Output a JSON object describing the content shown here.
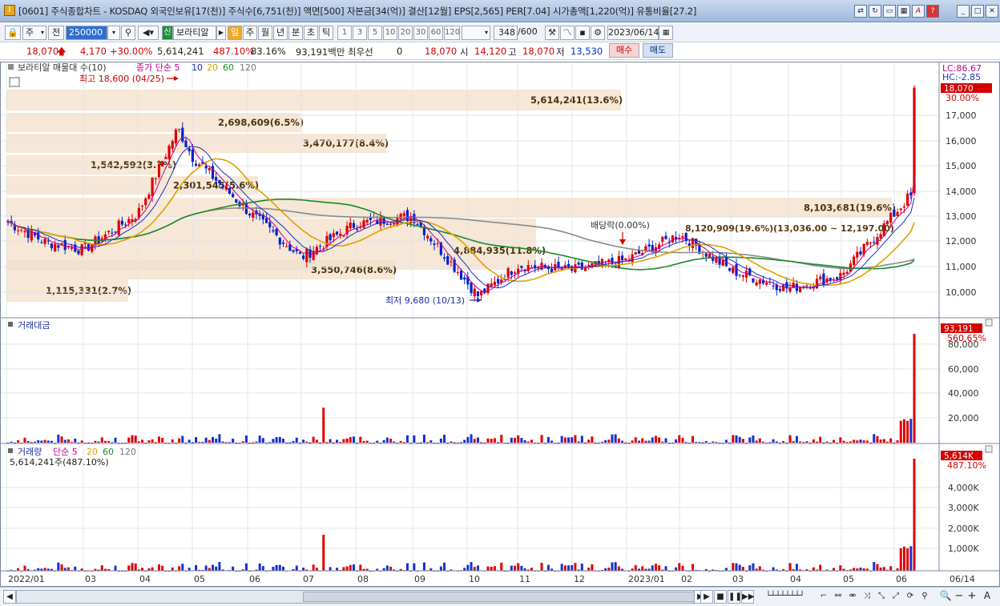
{
  "title": {
    "icon": "chart-app-icon",
    "text": "[0601] 주식종합차트 - KOSDAQ 외국인보유[17(천)] 주식수[6,751(천)] 액면[500] 자본금[34(억)] 결산[12월] EPS[2,565] PER[7.04] 시가총액[1,220(억)] 유통비율[27.2]",
    "buttons": [
      "link-icon",
      "refresh-icon",
      "window-icon",
      "table-icon",
      "font-icon",
      "help-icon",
      "minimize-icon",
      "maximize-icon",
      "close-icon"
    ]
  },
  "toolbar": {
    "type_select": "주",
    "prev_label": "전",
    "code_value": "250000",
    "stock_tag": "신",
    "stock_name": "보라티알",
    "periods": [
      "일",
      "주",
      "월",
      "년",
      "분",
      "초",
      "틱"
    ],
    "active_period": "일",
    "minute_steps": [
      "1",
      "3",
      "5",
      "10",
      "20",
      "30",
      "60",
      "120"
    ],
    "count_value": "348",
    "count_total": "/600",
    "date_value": "2023/06/14"
  },
  "pricebar": {
    "price": "18,070",
    "change": "4,170",
    "change_pct": "+30.00%",
    "volume": "5,614,241",
    "vol_ratio": "487.10%",
    "turnover": "83.16%",
    "trade_value": "93,191백만",
    "best_bid_label": "최우선",
    "best_bid": "0",
    "best_price": "18,070",
    "open_label": "시",
    "open": "14,120",
    "high_label": "고",
    "high": "18,070",
    "low_label": "저",
    "low": "13,530",
    "buy_label": "매수",
    "sell_label": "매도"
  },
  "legend": {
    "price": [
      "보라티알 매물대 수(10)",
      "종가 단순 5",
      "10",
      "20",
      "60",
      "120"
    ],
    "trade_value": "거래대금",
    "volume": [
      "거래량",
      "단순 5",
      "20",
      "60",
      "120"
    ],
    "volume_note": "5,614,241주(487.10%)"
  },
  "right_labels": {
    "lc": "LC:86.67",
    "hc": "HC:-2.85",
    "price_tag": "18,070",
    "price_pct": "30.00%",
    "value_tag": "93,191",
    "value_pct": "560.65%",
    "vol_tag": "5,614K",
    "vol_pct": "487.10%"
  },
  "annotations": {
    "high": "최고 18,600 (04/25)",
    "low": "최저 9,680 (10/13)",
    "dividend": "배당락(0.00%)",
    "range_note": "8,120,909(19.6%)(13,036.00 ~ 12,197.00)"
  },
  "volume_profile": [
    {
      "label": "5,614,241(13.6%)"
    },
    {
      "label": "2,698,609(6.5%)"
    },
    {
      "label": "3,470,177(8.4%)"
    },
    {
      "label": "1,542,592(3.7%)"
    },
    {
      "label": "2,301,545(5.6%)"
    },
    {
      "label": "8,103,681(19.6%)"
    },
    {
      "label": "4,884,935(11.8%)"
    },
    {
      "label": "3,550,746(8.6%)"
    },
    {
      "label": "1,115,331(2.7%)"
    }
  ],
  "chart_data": [
    {
      "type": "candlestick",
      "panel": "price",
      "y_ticks": [
        "30.00%",
        "17,000",
        "16,000",
        "15,000",
        "14,000",
        "13,000",
        "12,000",
        "11,000",
        "10,000"
      ],
      "ylim": [
        9500,
        18600
      ],
      "close_path": [
        [
          "2022/01",
          12900
        ],
        [
          "2022/02",
          12100
        ],
        [
          "2022/03",
          11800
        ],
        [
          "2022/04",
          13200
        ],
        [
          "2022/04/25",
          16500
        ],
        [
          "2022/05",
          15400
        ],
        [
          "2022/06",
          13300
        ],
        [
          "2022/07",
          11500
        ],
        [
          "2022/08",
          12800
        ],
        [
          "2022/09",
          13100
        ],
        [
          "2022/10/13",
          10000
        ],
        [
          "2022/11",
          11200
        ],
        [
          "2022/12",
          11000
        ],
        [
          "2023/01",
          11400
        ],
        [
          "2023/02",
          12400
        ],
        [
          "2023/03",
          11000
        ],
        [
          "2023/04",
          10300
        ],
        [
          "2023/05",
          10800
        ],
        [
          "2023/06/13",
          13900
        ],
        [
          "2023/06/14",
          18070
        ]
      ]
    },
    {
      "type": "bar",
      "panel": "trade_value",
      "y_ticks": [
        "80,000",
        "60,000",
        "40,000",
        "20,000"
      ],
      "ylim": [
        0,
        93191
      ],
      "last_value": 93191
    },
    {
      "type": "bar",
      "panel": "volume",
      "y_ticks": [
        "4,000K",
        "3,000K",
        "2,000K",
        "1,000K"
      ],
      "ylim": [
        0,
        5614
      ],
      "last_value": 5614
    }
  ],
  "x_ticks": [
    "2022/01",
    "03",
    "04",
    "05",
    "06",
    "07",
    "08",
    "09",
    "10",
    "11",
    "12",
    "2023/01",
    "02",
    "03",
    "04",
    "05",
    "06",
    "06/14"
  ]
}
